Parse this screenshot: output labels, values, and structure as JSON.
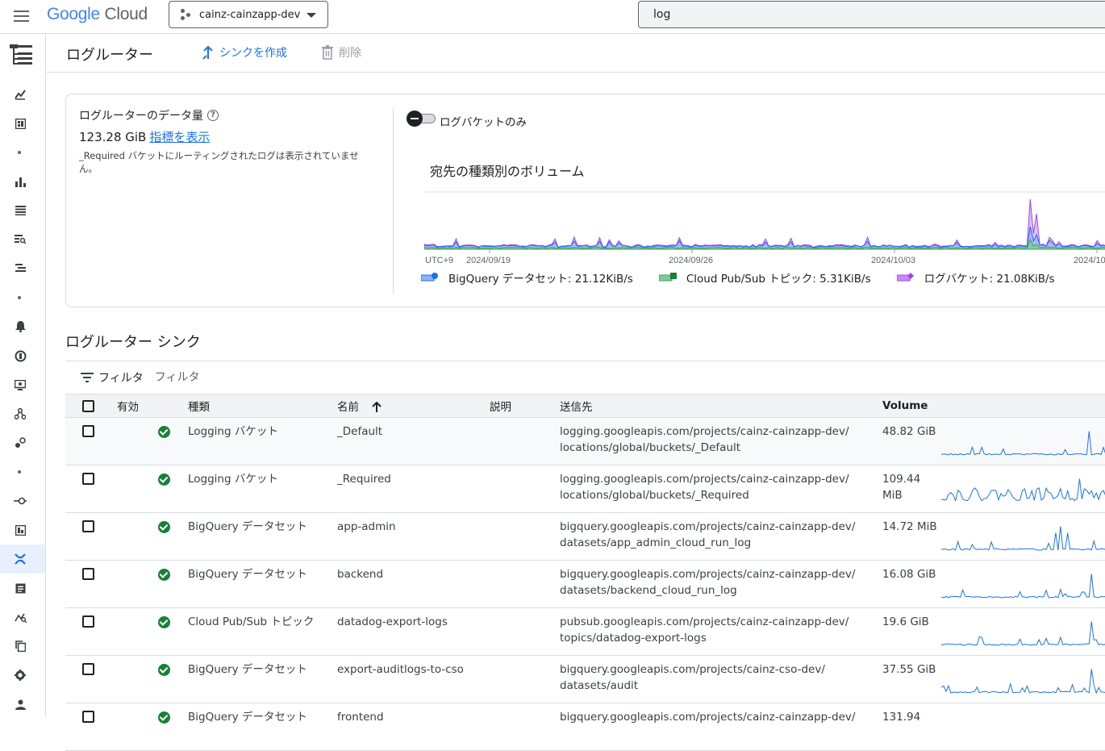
{
  "header": {
    "logo_google": "Google",
    "logo_cloud": "Cloud",
    "project": "cainz-cainzapp-dev",
    "search_value": "log"
  },
  "page": {
    "title": "ログルーター",
    "create_sink": "シンクを作成",
    "delete": "削除"
  },
  "summary": {
    "volume_title": "ログルーターのデータ量",
    "volume_value": "123.28 GiB",
    "view_metrics": "指標を表示",
    "note": "_Required バケットにルーティングされたログは表示されていません。",
    "toggle_label": "ログバケットのみ",
    "chart_title": "宛先の種類別のボリューム",
    "timezone": "UTC+9",
    "ticks": [
      "2024/09/19",
      "2024/09/26",
      "2024/10/03",
      "2024/10"
    ],
    "legend": [
      {
        "label": "BigQuery データセット: 21.12KiB/s",
        "color": "#1a73e8"
      },
      {
        "label": "Cloud Pub/Sub トピック: 5.31KiB/s",
        "color": "#34a853"
      },
      {
        "label": "ログバケット: 21.08KiB/s",
        "color": "#a142f4"
      }
    ]
  },
  "sinks": {
    "title": "ログルーター シンク",
    "filter_label": "フィルタ",
    "filter_placeholder": "フィルタ",
    "columns": {
      "enabled": "有効",
      "type": "種類",
      "name": "名前",
      "description": "説明",
      "destination": "送信先",
      "volume": "Volume"
    },
    "rows": [
      {
        "type": "Logging バケット",
        "name": "_Default",
        "dest1": "logging.googleapis.com/projects/cainz-cainzapp-dev/",
        "dest2": "locations/global/buckets/_Default",
        "vol1": "48.82 GiB",
        "vol2": ""
      },
      {
        "type": "Logging バケット",
        "name": "_Required",
        "dest1": "logging.googleapis.com/projects/cainz-cainzapp-dev/",
        "dest2": "locations/global/buckets/_Required",
        "vol1": "109.44",
        "vol2": "MiB"
      },
      {
        "type": "BigQuery データセット",
        "name": "app-admin",
        "dest1": "bigquery.googleapis.com/projects/cainz-cainzapp-dev/",
        "dest2": "datasets/app_admin_cloud_run_log",
        "vol1": "14.72 MiB",
        "vol2": ""
      },
      {
        "type": "BigQuery データセット",
        "name": "backend",
        "dest1": "bigquery.googleapis.com/projects/cainz-cainzapp-dev/",
        "dest2": "datasets/backend_cloud_run_log",
        "vol1": "16.08 GiB",
        "vol2": ""
      },
      {
        "type": "Cloud Pub/Sub トピック",
        "name": "datadog-export-logs",
        "dest1": "pubsub.googleapis.com/projects/cainz-cainzapp-dev/",
        "dest2": "topics/datadog-export-logs",
        "vol1": "19.6 GiB",
        "vol2": ""
      },
      {
        "type": "BigQuery データセット",
        "name": "export-auditlogs-to-cso",
        "dest1": "bigquery.googleapis.com/projects/cainz-cso-dev/",
        "dest2": "datasets/audit",
        "vol1": "37.55 GiB",
        "vol2": ""
      },
      {
        "type": "BigQuery データセット",
        "name": "frontend",
        "dest1": "bigquery.googleapis.com/projects/cainz-cainzapp-dev/",
        "dest2": "",
        "vol1": "131.94",
        "vol2": ""
      }
    ]
  }
}
